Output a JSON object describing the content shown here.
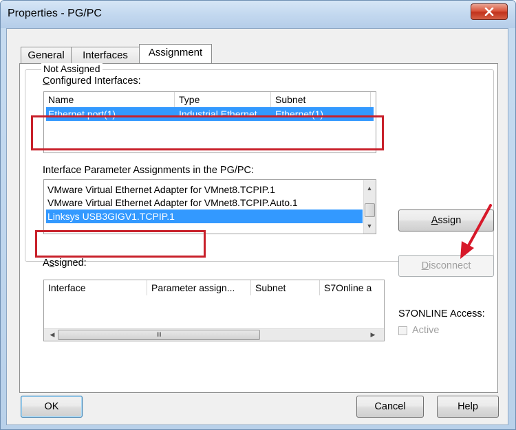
{
  "window": {
    "title": "Properties - PG/PC",
    "close_glyph": "✕"
  },
  "tabs": [
    {
      "label": "General",
      "active": false
    },
    {
      "label": "Interfaces",
      "active": false
    },
    {
      "label": "Assignment",
      "active": true
    }
  ],
  "not_assigned": {
    "group_label": "Not Assigned",
    "configured_label_accel": "C",
    "configured_label_rest": "onfigured Interfaces:",
    "configured_columns": [
      "Name",
      "Type",
      "Subnet"
    ],
    "configured_rows": [
      {
        "name": "Ethernet port(1)",
        "type": "Industrial Ethernet",
        "subnet": "Ethernet(1)",
        "selected": true
      }
    ],
    "param_label": "Interface Parameter Assignments in the PG/PC:",
    "param_items": [
      {
        "label": "VMware Virtual Ethernet Adapter for VMnet8.TCPIP.1",
        "selected": false
      },
      {
        "label": "VMware Virtual Ethernet Adapter for VMnet8.TCPIP.Auto.1",
        "selected": false
      },
      {
        "label": "Linksys USB3GIGV1.TCPIP.1",
        "selected": true
      }
    ],
    "assign_button_accel": "A",
    "assign_button_rest": "ssign"
  },
  "assigned": {
    "label_accel": "s",
    "label_pre": "A",
    "label_post": "signed:",
    "columns": [
      "Interface",
      "Parameter assign...",
      "Subnet",
      "S7Online a"
    ],
    "hscroll_thumb_glyph": "III",
    "disconnect_button_accel": "D",
    "disconnect_button_rest": "isconnect",
    "s7online_label": "S7ONLINE Access:",
    "active_checkbox_label": "Active",
    "active_checked": false
  },
  "footer": {
    "ok": "OK",
    "cancel": "Cancel",
    "help": "Help"
  },
  "colors": {
    "highlight": "#c8202a",
    "selection": "#3399ff",
    "arrow": "#d7192a"
  }
}
